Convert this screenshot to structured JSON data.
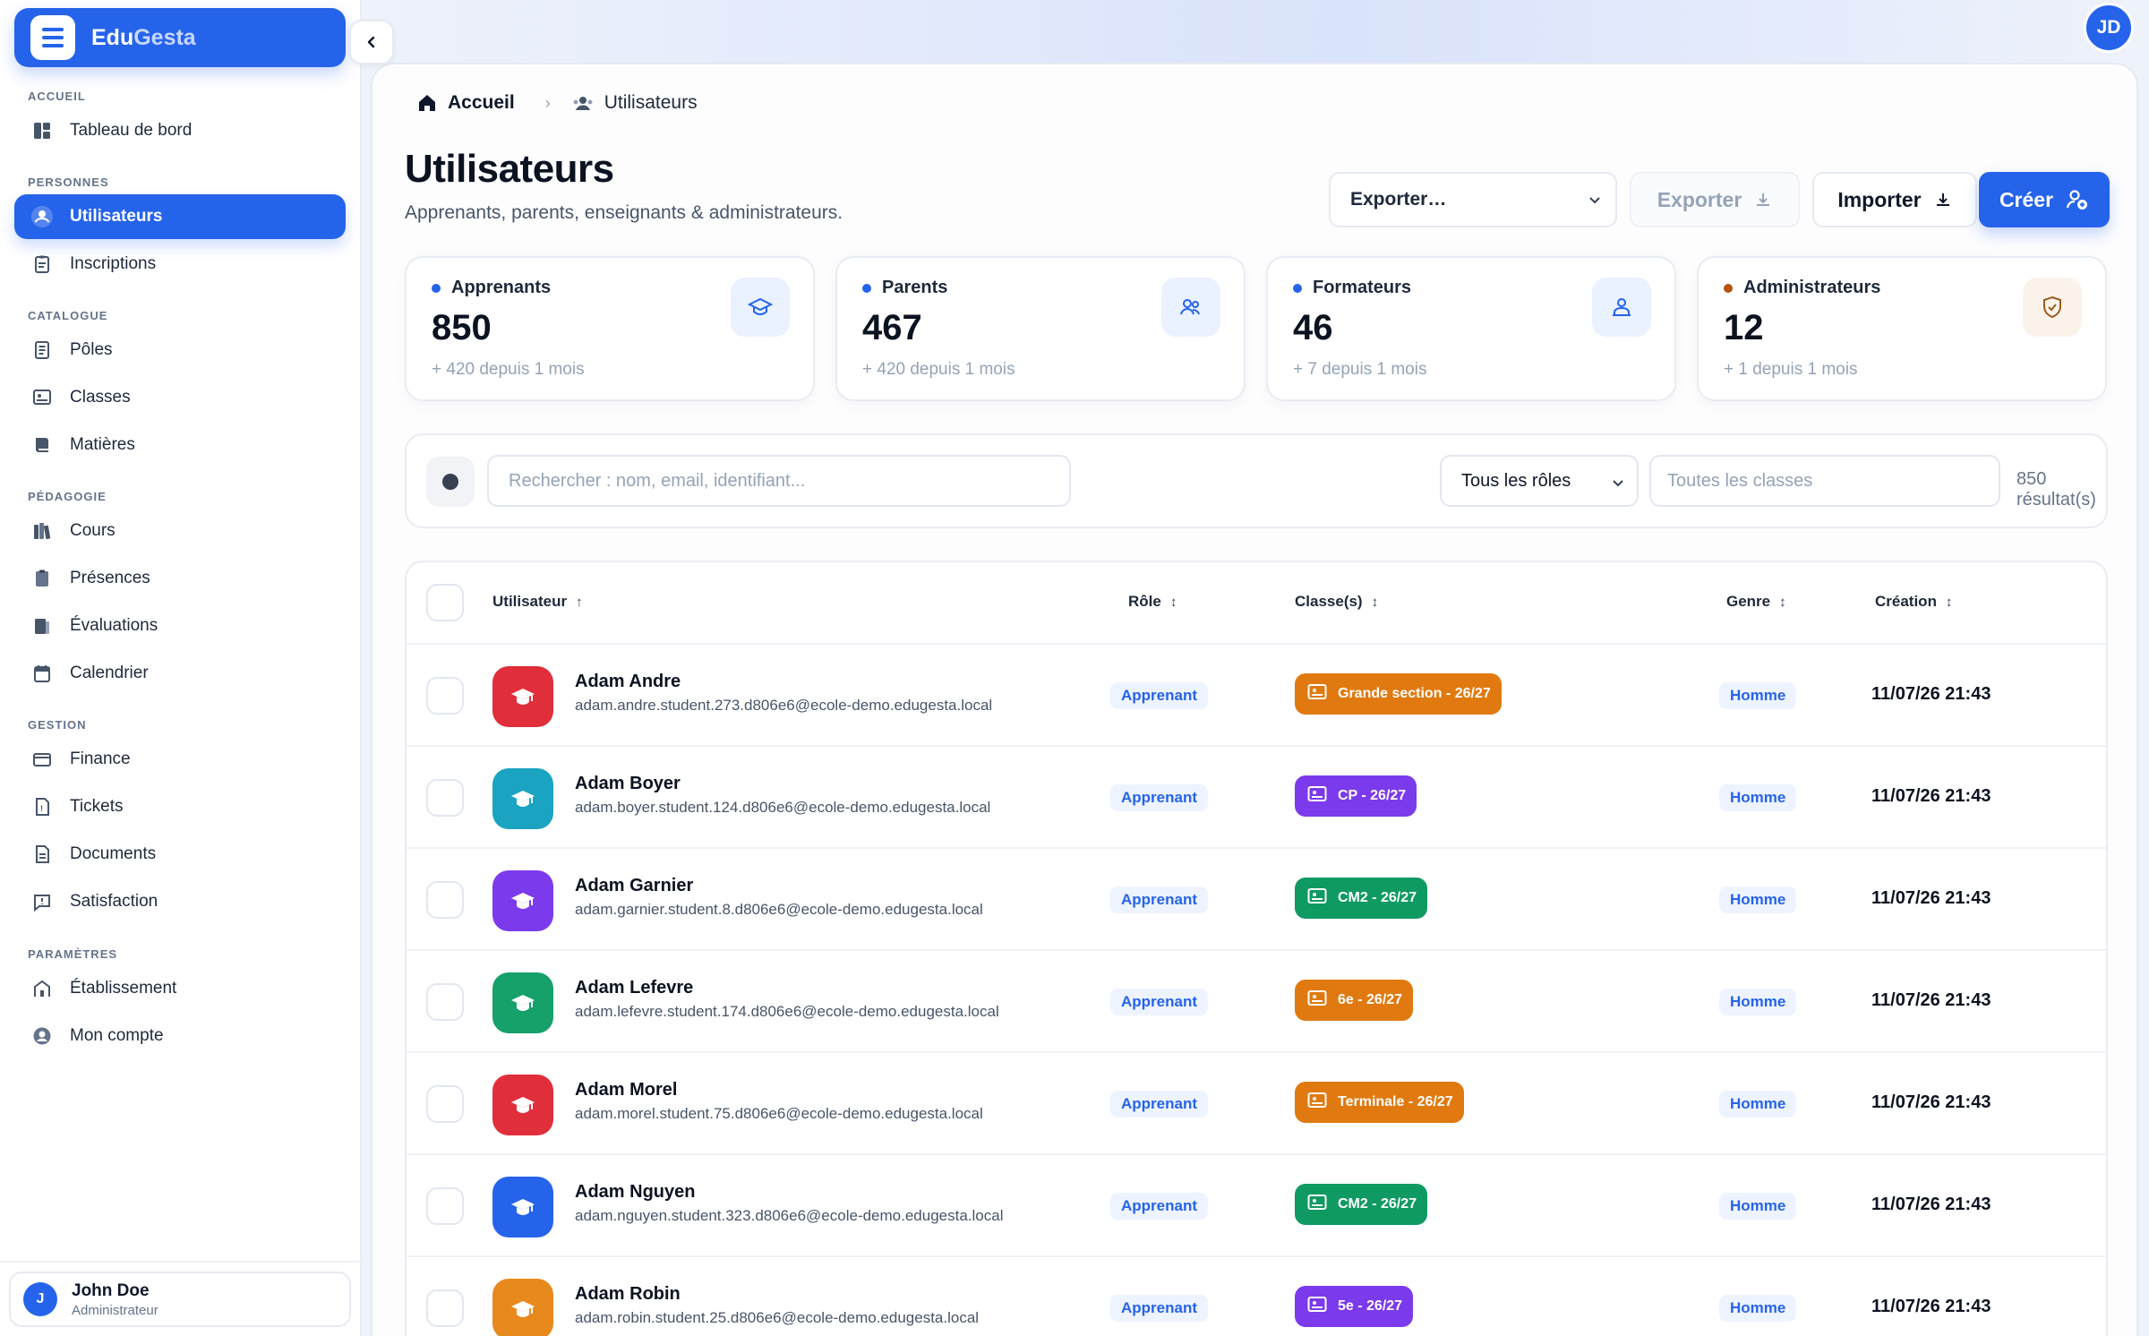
{
  "app": {
    "name_part1": "Edu",
    "name_part2": "Gesta"
  },
  "sidebar": {
    "sections": [
      {
        "label": "ACCUEIL"
      },
      {
        "label": "PERSONNES"
      },
      {
        "label": "CATALOGUE"
      },
      {
        "label": "PÉDAGOGIE"
      },
      {
        "label": "GESTION"
      },
      {
        "label": "PARAMÈTRES"
      }
    ],
    "items": [
      {
        "label": "Tableau de bord",
        "icon": "dashboard-icon"
      },
      {
        "label": "Utilisateurs",
        "icon": "users-icon",
        "active": true
      },
      {
        "label": "Inscriptions",
        "icon": "clipboard-icon"
      },
      {
        "label": "Pôles",
        "icon": "document-icon"
      },
      {
        "label": "Classes",
        "icon": "classroom-icon"
      },
      {
        "label": "Matières",
        "icon": "book-icon"
      },
      {
        "label": "Cours",
        "icon": "books-icon"
      },
      {
        "label": "Présences",
        "icon": "clipboard-check-icon"
      },
      {
        "label": "Évaluations",
        "icon": "grade-icon"
      },
      {
        "label": "Calendrier",
        "icon": "calendar-icon"
      },
      {
        "label": "Finance",
        "icon": "wallet-icon"
      },
      {
        "label": "Tickets",
        "icon": "ticket-icon"
      },
      {
        "label": "Documents",
        "icon": "file-icon"
      },
      {
        "label": "Satisfaction",
        "icon": "feedback-icon"
      },
      {
        "label": "Établissement",
        "icon": "building-icon"
      },
      {
        "label": "Mon compte",
        "icon": "account-icon"
      }
    ],
    "user": {
      "initial": "J",
      "name": "John Doe",
      "role": "Administrateur"
    }
  },
  "topbar": {
    "avatar_initials": "JD"
  },
  "breadcrumb": {
    "home": "Accueil",
    "current": "Utilisateurs"
  },
  "header": {
    "title": "Utilisateurs",
    "subtitle": "Apprenants, parents, enseignants & administrateurs.",
    "export_select": "Exporter…",
    "export_button": "Exporter",
    "import_button": "Importer",
    "create_button": "Créer"
  },
  "stats": [
    {
      "label": "Apprenants",
      "value": "850",
      "delta": "+ 420 depuis 1 mois",
      "dot_color": "#2563eb",
      "icon": "graduation-cap-icon",
      "icon_bg": "#eaf1ff",
      "icon_color": "#2563eb"
    },
    {
      "label": "Parents",
      "value": "467",
      "delta": "+ 420 depuis 1 mois",
      "dot_color": "#2563eb",
      "icon": "family-icon",
      "icon_bg": "#eaf1ff",
      "icon_color": "#2563eb"
    },
    {
      "label": "Formateurs",
      "value": "46",
      "delta": "+ 7 depuis 1 mois",
      "dot_color": "#2563eb",
      "icon": "teacher-icon",
      "icon_bg": "#eaf1ff",
      "icon_color": "#2563eb"
    },
    {
      "label": "Administrateurs",
      "value": "12",
      "delta": "+ 1 depuis 1 mois",
      "dot_color": "#b45309",
      "icon": "shield-icon",
      "icon_bg": "#fbf3ea",
      "icon_color": "#9a5a1a"
    }
  ],
  "filters": {
    "search_placeholder": "Rechercher : nom, email, identifiant...",
    "role_select": "Tous les rôles",
    "class_placeholder": "Toutes les classes",
    "result_count": "850 résultat(s)"
  },
  "table": {
    "columns": {
      "user": "Utilisateur",
      "role": "Rôle",
      "classes": "Classe(s)",
      "genre": "Genre",
      "created": "Création"
    },
    "rows": [
      {
        "name": "Adam Andre",
        "email": "adam.andre.student.273.d806e6@ecole-demo.edugesta.local",
        "role": "Apprenant",
        "class": "Grande section - 26/27",
        "class_color": "#e07a10",
        "genre": "Homme",
        "created": "11/07/26 21:43",
        "avatar_color": "#e02f3a"
      },
      {
        "name": "Adam Boyer",
        "email": "adam.boyer.student.124.d806e6@ecole-demo.edugesta.local",
        "role": "Apprenant",
        "class": "CP - 26/27",
        "class_color": "#7c3aed",
        "genre": "Homme",
        "created": "11/07/26 21:43",
        "avatar_color": "#1ba3c2"
      },
      {
        "name": "Adam Garnier",
        "email": "adam.garnier.student.8.d806e6@ecole-demo.edugesta.local",
        "role": "Apprenant",
        "class": "CM2 - 26/27",
        "class_color": "#0f9a62",
        "genre": "Homme",
        "created": "11/07/26 21:43",
        "avatar_color": "#7c3aed"
      },
      {
        "name": "Adam Lefevre",
        "email": "adam.lefevre.student.174.d806e6@ecole-demo.edugesta.local",
        "role": "Apprenant",
        "class": "6e - 26/27",
        "class_color": "#e07a10",
        "genre": "Homme",
        "created": "11/07/26 21:43",
        "avatar_color": "#16a06a"
      },
      {
        "name": "Adam Morel",
        "email": "adam.morel.student.75.d806e6@ecole-demo.edugesta.local",
        "role": "Apprenant",
        "class": "Terminale - 26/27",
        "class_color": "#e07a10",
        "genre": "Homme",
        "created": "11/07/26 21:43",
        "avatar_color": "#e02f3a"
      },
      {
        "name": "Adam Nguyen",
        "email": "adam.nguyen.student.323.d806e6@ecole-demo.edugesta.local",
        "role": "Apprenant",
        "class": "CM2 - 26/27",
        "class_color": "#0f9a62",
        "genre": "Homme",
        "created": "11/07/26 21:43",
        "avatar_color": "#2563eb"
      },
      {
        "name": "Adam Robin",
        "email": "adam.robin.student.25.d806e6@ecole-demo.edugesta.local",
        "role": "Apprenant",
        "class": "5e - 26/27",
        "class_color": "#7c3aed",
        "genre": "Homme",
        "created": "11/07/26 21:43",
        "avatar_color": "#e8891d"
      }
    ]
  }
}
